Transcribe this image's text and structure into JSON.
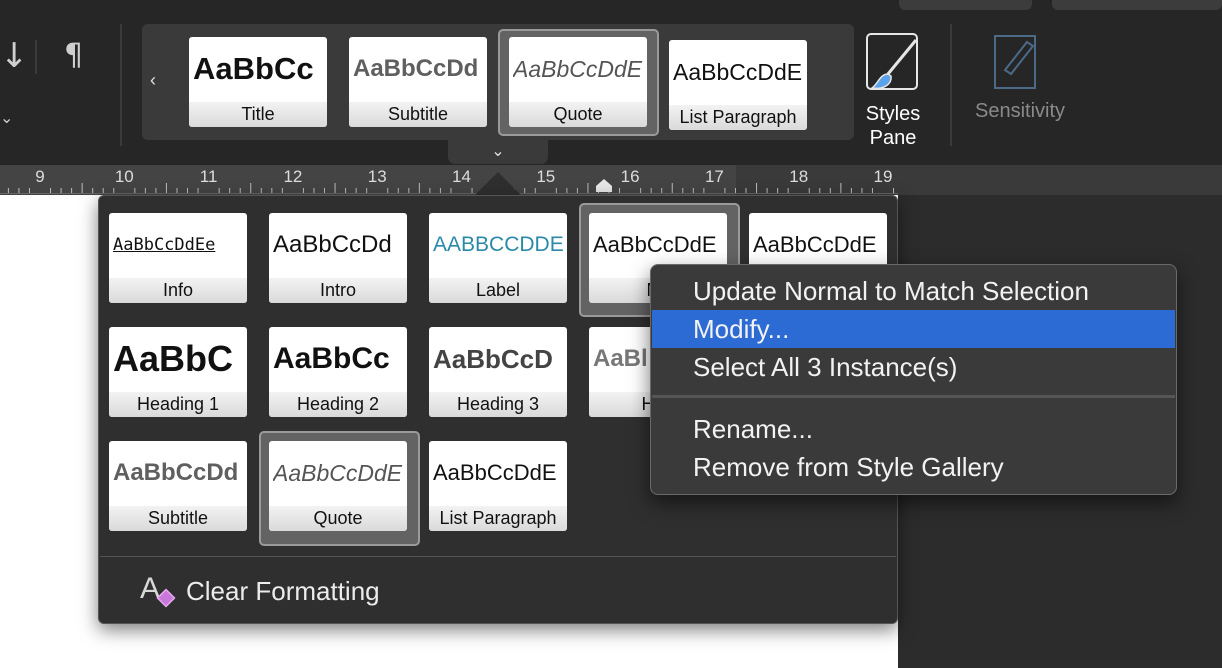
{
  "ribbon": {
    "pilcrow_glyph": "¶",
    "sort_glyph": "↓",
    "gallery_prev_glyph": "‹",
    "expand_glyph": "⌄",
    "styles_pane_line1": "Styles",
    "styles_pane_line2": "Pane",
    "sensitivity_label": "Sensitivity"
  },
  "gallery_tiles": [
    {
      "sample": "AaBbCc",
      "label": "Title"
    },
    {
      "sample": "AaBbCcDd",
      "label": "Subtitle"
    },
    {
      "sample": "AaBbCcDdE",
      "label": "Quote"
    },
    {
      "sample": "AaBbCcDdE",
      "label": "List Paragraph"
    }
  ],
  "ruler": {
    "numbers": [
      "9",
      "10",
      "11",
      "12",
      "13",
      "14",
      "15",
      "16",
      "17",
      "18",
      "19"
    ]
  },
  "style_grid": [
    {
      "sample": "AaBbCcDdEe",
      "label": "Info"
    },
    {
      "sample": "AaBbCcDd",
      "label": "Intro"
    },
    {
      "sample": "AABBCCDDE",
      "label": "Label"
    },
    {
      "sample": "AaBbCcDdE",
      "label": "No"
    },
    {
      "sample": "AaBbCcDdE",
      "label": ""
    },
    {
      "sample": "AaBbC",
      "label": "Heading 1"
    },
    {
      "sample": "AaBbCc",
      "label": "Heading 2"
    },
    {
      "sample": "AaBbCcD",
      "label": "Heading 3"
    },
    {
      "sample": "AaBl",
      "label": "Hea"
    },
    {
      "sample": "AaBbCcDd",
      "label": "Subtitle"
    },
    {
      "sample": "AaBbCcDdE",
      "label": "Quote"
    },
    {
      "sample": "AaBbCcDdE",
      "label": "List Paragraph"
    }
  ],
  "clear_formatting": "Clear Formatting",
  "context_menu": {
    "items": [
      "Update Normal to Match Selection",
      "Modify...",
      "Select All 3 Instance(s)",
      "Rename...",
      "Remove from Style Gallery"
    ],
    "highlighted": "Modify..."
  },
  "colors": {
    "highlight": "#2c6ad4",
    "label_style_text": "#2a8aa8"
  }
}
